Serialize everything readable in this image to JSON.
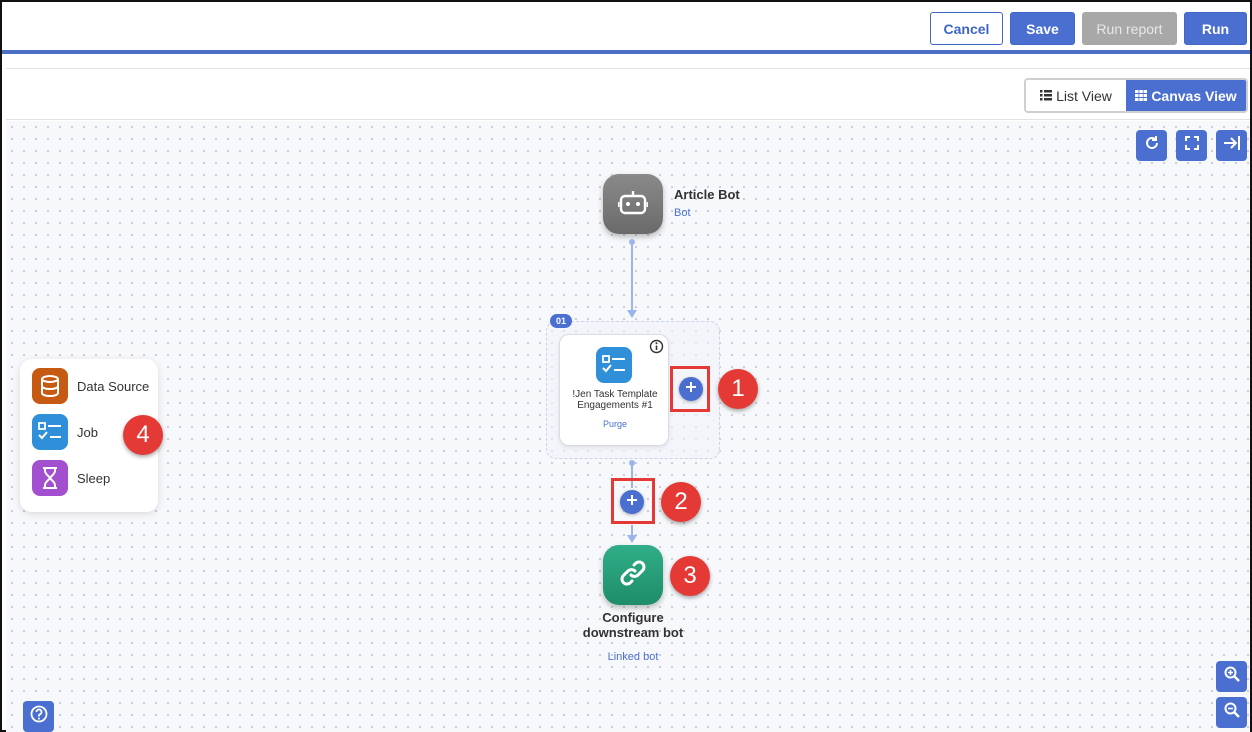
{
  "toolbar": {
    "cancel_label": "Cancel",
    "save_label": "Save",
    "run_report_label": "Run report",
    "run_label": "Run"
  },
  "view_toggle": {
    "list_label": "List View",
    "canvas_label": "Canvas View",
    "active": "Canvas View"
  },
  "canvas_tools": {
    "refresh_icon": "refresh-icon",
    "fullscreen_icon": "fullscreen-icon",
    "collapse_icon": "collapse-panel-icon",
    "zoom_in_icon": "zoom-in-icon",
    "zoom_out_icon": "zoom-out-icon",
    "help_icon": "help-icon"
  },
  "bot_node": {
    "title": "Article Bot",
    "subtitle": "Bot",
    "icon": "robot-icon"
  },
  "task_group": {
    "badge": "01",
    "task": {
      "title": "!Jen Task Template Engagements #1",
      "subtitle": "Purge",
      "icon": "task-list-icon"
    }
  },
  "linked_node": {
    "title": "Configure downstream bot",
    "subtitle": "Linked bot",
    "icon": "link-icon"
  },
  "palette": {
    "items": [
      {
        "label": "Data Source",
        "icon": "database-icon",
        "color": "#c65a12"
      },
      {
        "label": "Job",
        "icon": "task-list-icon",
        "color": "#2f8fd8"
      },
      {
        "label": "Sleep",
        "icon": "hourglass-icon",
        "color": "#a24fd0"
      }
    ]
  },
  "callouts": [
    "1",
    "2",
    "3",
    "4"
  ],
  "colors": {
    "accent": "#4a6fd0",
    "callout": "#e53935",
    "connector": "#9bb5ec"
  }
}
